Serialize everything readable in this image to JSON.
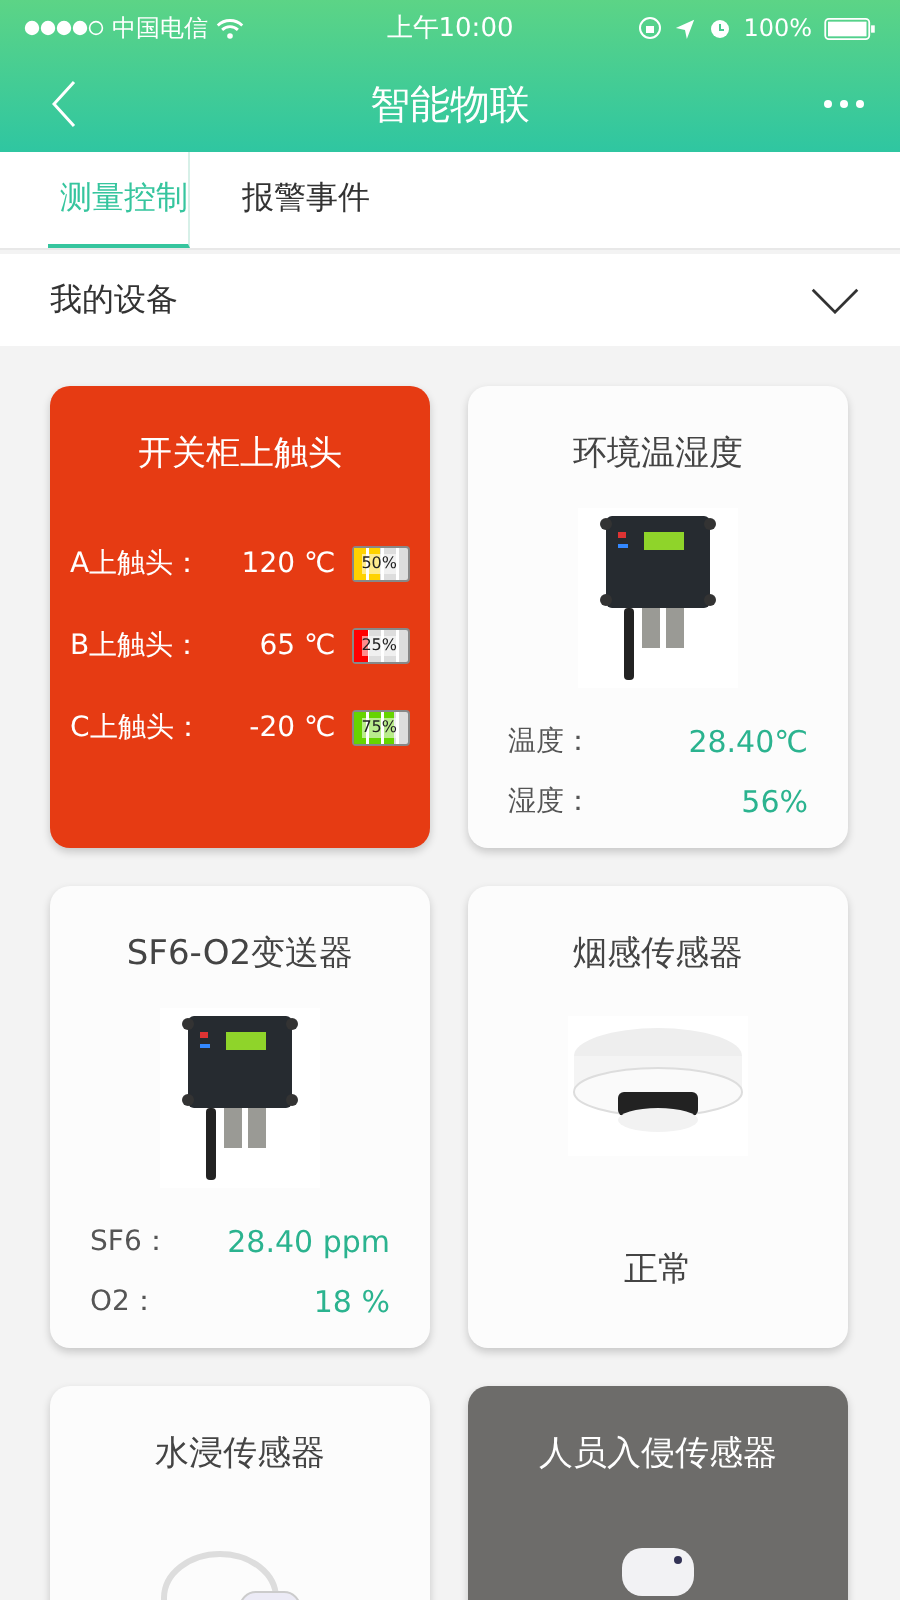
{
  "status_bar": {
    "carrier": "中国电信",
    "time": "上午10:00",
    "battery": "100%"
  },
  "nav": {
    "title": "智能物联"
  },
  "tabs": [
    {
      "label": "测量控制",
      "selected": true
    },
    {
      "label": "报警事件",
      "selected": false
    }
  ],
  "device_selector": {
    "label": "我的设备"
  },
  "cards": [
    {
      "title": "开关柜上触头",
      "alarm": true,
      "offline": false,
      "kind": "batteries",
      "rows": [
        {
          "label": "A上触头：",
          "value": "120 ℃",
          "level": 0.5,
          "percent": "50%"
        },
        {
          "label": "B上触头：",
          "value": "65 ℃",
          "level": 0.25,
          "percent": "25%"
        },
        {
          "label": "C上触头：",
          "value": "-20 ℃",
          "level": 0.75,
          "percent": "75%"
        }
      ]
    },
    {
      "title": "环境温湿度",
      "alarm": false,
      "offline": false,
      "kind": "readings",
      "rows": [
        {
          "label": "温度：",
          "value": "28.40℃"
        },
        {
          "label": "湿度：",
          "value": "56%"
        }
      ]
    },
    {
      "title": "SF6-O2变送器",
      "alarm": false,
      "offline": false,
      "kind": "readings",
      "rows": [
        {
          "label": "SF6：",
          "value": "28.40 ppm"
        },
        {
          "label": "O2：",
          "value": "18 %"
        }
      ]
    },
    {
      "title": "烟感传感器",
      "alarm": false,
      "offline": false,
      "kind": "state",
      "state": "正常"
    },
    {
      "title": "水浸传感器",
      "alarm": false,
      "offline": false,
      "kind": "state"
    },
    {
      "title": "人员入侵传感器",
      "alarm": false,
      "offline": true,
      "kind": "state"
    }
  ]
}
